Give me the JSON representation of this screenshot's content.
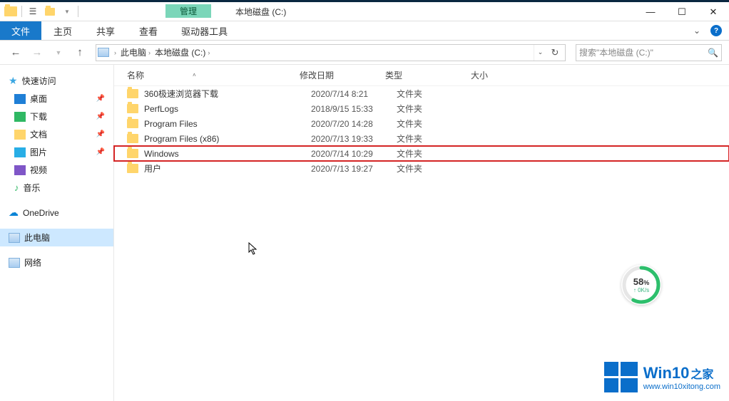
{
  "titlebar": {
    "contextual_label": "管理",
    "title": "本地磁盘 (C:)"
  },
  "ribbon": {
    "file": "文件",
    "tabs": [
      "主页",
      "共享",
      "查看"
    ],
    "contextual": "驱动器工具"
  },
  "nav": {
    "breadcrumbs": [
      "此电脑",
      "本地磁盘 (C:)"
    ],
    "search_placeholder": "搜索\"本地磁盘 (C:)\""
  },
  "sidebar": {
    "quick_access": "快速访问",
    "pinned": [
      {
        "label": "桌面",
        "icon": "desktop"
      },
      {
        "label": "下载",
        "icon": "download"
      },
      {
        "label": "文档",
        "icon": "document"
      },
      {
        "label": "图片",
        "icon": "picture"
      }
    ],
    "recent": [
      {
        "label": "视频",
        "icon": "video"
      },
      {
        "label": "音乐",
        "icon": "music"
      }
    ],
    "onedrive": "OneDrive",
    "thispc": "此电脑",
    "network": "网络"
  },
  "columns": {
    "name": "名称",
    "date": "修改日期",
    "type": "类型",
    "size": "大小"
  },
  "files": [
    {
      "name": "360极速浏览器下载",
      "date": "2020/7/14 8:21",
      "type": "文件夹",
      "hl": false
    },
    {
      "name": "PerfLogs",
      "date": "2018/9/15 15:33",
      "type": "文件夹",
      "hl": false
    },
    {
      "name": "Program Files",
      "date": "2020/7/20 14:28",
      "type": "文件夹",
      "hl": false
    },
    {
      "name": "Program Files (x86)",
      "date": "2020/7/13 19:33",
      "type": "文件夹",
      "hl": false
    },
    {
      "name": "Windows",
      "date": "2020/7/14 10:29",
      "type": "文件夹",
      "hl": true
    },
    {
      "name": "用户",
      "date": "2020/7/13 19:27",
      "type": "文件夹",
      "hl": false
    }
  ],
  "speedball": {
    "percent": "58",
    "unit": "%",
    "sub": "↑ 0K/s"
  },
  "watermark": {
    "brand": "Win10",
    "suffix": "之家",
    "url": "www.win10xitong.com"
  }
}
